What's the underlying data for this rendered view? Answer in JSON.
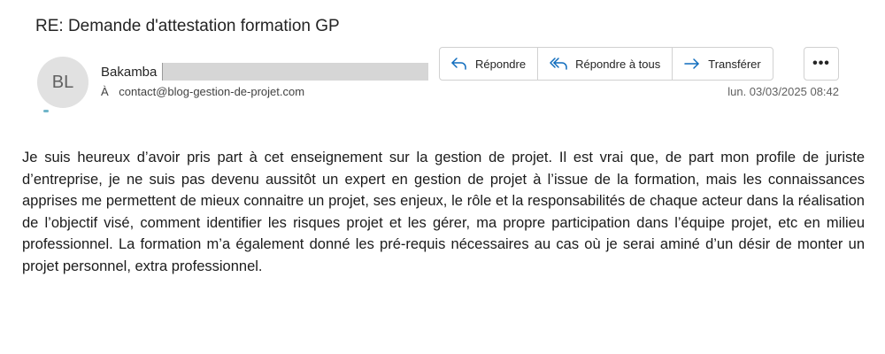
{
  "email": {
    "subject": "RE: Demande d'attestation formation GP",
    "avatar_initials": "BL",
    "sender_name": "Bakamba",
    "to_label": "À",
    "recipient": "contact@blog-gestion-de-projet.com",
    "timestamp": "lun. 03/03/2025 08:42",
    "body": "Je suis heureux d’avoir pris part à cet enseignement sur la gestion de projet. Il est vrai que, de part mon profile de juriste d’entreprise, je ne suis pas devenu aussitôt un expert en gestion de projet à l’issue de la formation, mais les connaissances apprises me permettent de mieux connaitre un projet, ses enjeux, le rôle et la responsabilités de chaque acteur dans la réalisation de l’objectif visé, comment identifier les risques projet et les gérer, ma propre participation dans l’équipe projet, etc en milieu professionnel. La formation m’a également donné les pré-requis nécessaires au cas où je serai aminé d’un désir de monter un projet personnel, extra professionnel."
  },
  "toolbar": {
    "reply_label": "Répondre",
    "reply_all_label": "Répondre à tous",
    "forward_label": "Transférer",
    "more_label": "•••",
    "reply_icon": "reply-arrow-icon",
    "reply_all_icon": "reply-all-arrow-icon",
    "forward_icon": "forward-arrow-icon"
  },
  "colors": {
    "accent": "#0f6cbd",
    "avatar_bg": "#e1e1e1"
  }
}
